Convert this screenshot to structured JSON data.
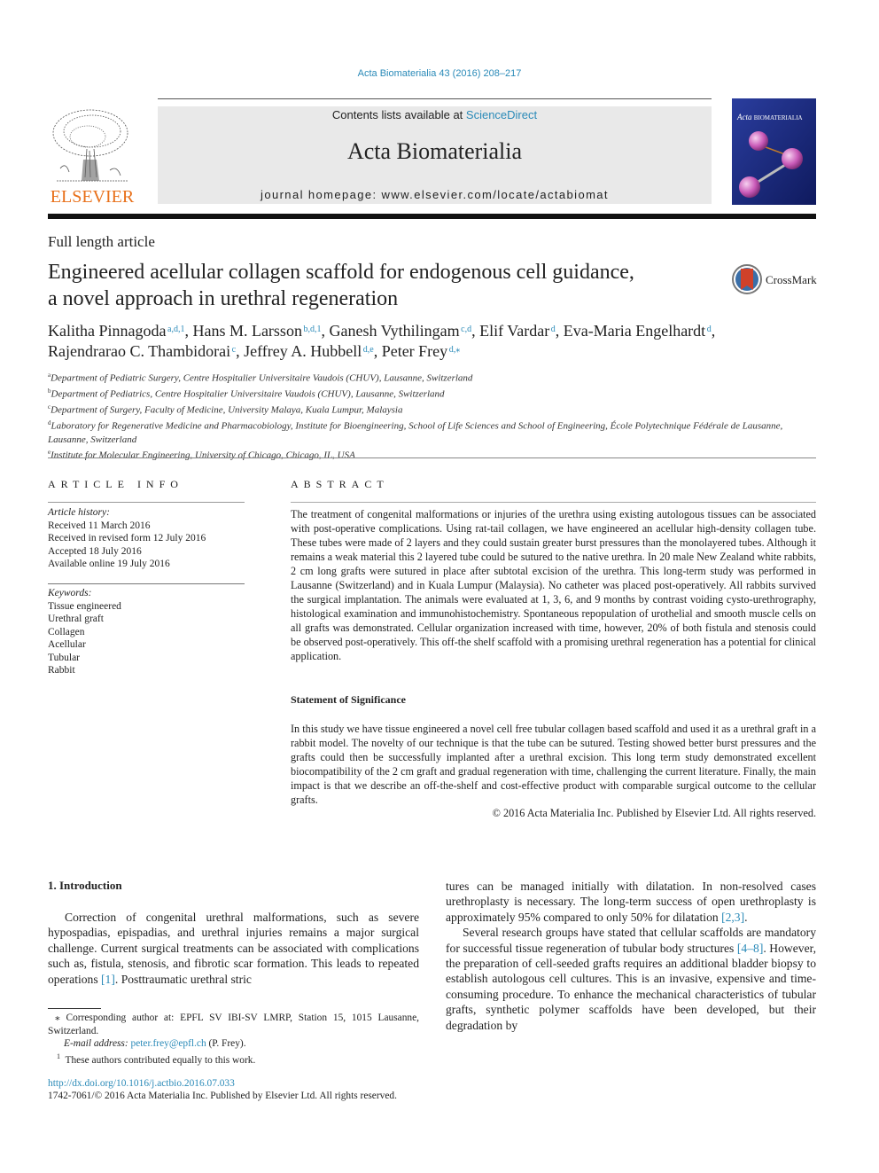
{
  "journal_reference": "Acta Biomaterialia 43 (2016) 208–217",
  "header": {
    "publisher_logo_text": "ELSEVIER",
    "contents_prefix": "Contents lists available at ",
    "contents_link": "ScienceDirect",
    "journal_title": "Acta Biomaterialia",
    "homepage": "journal homepage: www.elsevier.com/locate/actabiomat",
    "cover_title_italic": "Acta",
    "cover_title": "BIOMATERIALIA"
  },
  "article": {
    "type": "Full length article",
    "title_line1": "Engineered acellular collagen scaffold for endogenous cell guidance,",
    "title_line2": "a novel approach in urethral regeneration",
    "crossmark_label": "CrossMark",
    "authors": [
      {
        "name": "Kalitha Pinnagoda",
        "sup": "a,d,1",
        "sep": ", "
      },
      {
        "name": "Hans M. Larsson",
        "sup": "b,d,1",
        "sep": ", "
      },
      {
        "name": "Ganesh Vythilingam",
        "sup": "c,d",
        "sep": ", "
      },
      {
        "name": "Elif Vardar",
        "sup": "d",
        "sep": ", "
      },
      {
        "name": "Eva-Maria Engelhardt",
        "sup": "d",
        "sep": ","
      },
      {
        "name": "Rajendrarao C. Thambidorai",
        "sup": "c",
        "sep": ", "
      },
      {
        "name": "Jeffrey A. Hubbell",
        "sup": "d,e",
        "sep": ", "
      },
      {
        "name": "Peter Frey",
        "sup": "d,⁎",
        "sep": ""
      }
    ],
    "affiliations": [
      {
        "key": "a",
        "text": "Department of Pediatric Surgery, Centre Hospitalier Universitaire Vaudois (CHUV), Lausanne, Switzerland"
      },
      {
        "key": "b",
        "text": "Department of Pediatrics, Centre Hospitalier Universitaire Vaudois (CHUV), Lausanne, Switzerland"
      },
      {
        "key": "c",
        "text": "Department of Surgery, Faculty of Medicine, University Malaya, Kuala Lumpur, Malaysia"
      },
      {
        "key": "d",
        "text": "Laboratory for Regenerative Medicine and Pharmacobiology, Institute for Bioengineering, School of Life Sciences and School of Engineering, École Polytechnique Fédérale de Lausanne, Lausanne, Switzerland"
      },
      {
        "key": "e",
        "text": "Institute for Molecular Engineering, University of Chicago, Chicago, IL, USA"
      }
    ]
  },
  "article_info": {
    "heading": "ARTICLE INFO",
    "history_label": "Article history:",
    "history": [
      "Received 11 March 2016",
      "Received in revised form 12 July 2016",
      "Accepted 18 July 2016",
      "Available online 19 July 2016"
    ],
    "keywords_label": "Keywords:",
    "keywords": [
      "Tissue engineered",
      "Urethral graft",
      "Collagen",
      "Acellular",
      "Tubular",
      "Rabbit"
    ]
  },
  "abstract": {
    "heading": "ABSTRACT",
    "text": "The treatment of congenital malformations or injuries of the urethra using existing autologous tissues can be associated with post-operative complications. Using rat-tail collagen, we have engineered an acel­lular high-density collagen tube. These tubes were made of 2 layers and they could sustain greater burst pressures than the monolayered tubes. Although it remains a weak material this 2 layered tube could be sutured to the native urethra. In 20 male New Zealand white rabbits, 2 cm long grafts were sutured in place after subtotal excision of the urethra. This long-term study was performed in Lausanne (Switzerland) and in Kuala Lumpur (Malaysia). No catheter was placed post-operatively. All rabbits survived the surgical implantation. The animals were evaluated at 1, 3, 6, and 9 months by contrast voiding cysto-urethrography, histological examination and immunohistochemistry. Spontaneous re­population of urothelial and smooth muscle cells on all grafts was demonstrated. Cellular organization increased with time, however, 20% of both fistula and stenosis could be observed post-operatively. This off-the shelf scaffold with a promising urethral regeneration has a potential for clinical application.",
    "significance_heading": "Statement of Significance",
    "significance_text": "In this study we have tissue engineered a novel cell free tubular collagen based scaffold and used it as a urethral graft in a rabbit model. The novelty of our technique is that the tube can be sutured. Testing showed better burst pressures and the grafts could then be successfully implanted after a urethral excision. This long term study demonstrated excellent biocompatibility of the 2 cm graft and gradual regeneration with time, challenging the current literature. Finally, the main impact is that we describe an off-the-shelf and cost-effective product with comparable surgical outcome to the cellular grafts.",
    "copyright": "© 2016 Acta Materialia Inc. Published by Elsevier Ltd. All rights reserved."
  },
  "introduction": {
    "heading": "1. Introduction",
    "p1_a": "Correction of congenital urethral malformations, such as severe hypospadias, epispadias, and urethral injuries remains a major sur­gical challenge. Current surgical treatments can be associated with complications such as, fistula, stenosis, and fibrotic scar formation. This leads to repeated operations ",
    "p1_ref": "[1]",
    "p1_b": ". Posttraumatic urethral stric­",
    "col2_a": "tures can be managed initially with dilatation. In non-resolved cases urethroplasty is necessary. The long-term success of open urethroplasty is approximately 95% compared to only 50% for dilatation ",
    "col2_ref1": "[2,3]",
    "col2_b": ".",
    "p2_a": "Several research groups have stated that cellular scaffolds are mandatory for successful tissue regeneration of tubular body struc­tures ",
    "p2_ref": "[4–8]",
    "p2_b": ". However, the preparation of cell-seeded grafts requires an additional bladder biopsy to establish autologous cell cultures. This is an invasive, expensive and time-consuming procedure. To enhance the mechanical characteristics of tubular grafts, synthetic polymer scaffolds have been developed, but their degradation by"
  },
  "footnotes": {
    "corresponding": "⁎ Corresponding author at: EPFL SV IBI-SV LMRP, Station 15, 1015 Lausanne, Switzerland.",
    "email_label": "E-mail address: ",
    "email": "peter.frey@epfl.ch",
    "email_suffix": " (P. Frey).",
    "equal_sup": "1",
    "equal": "These authors contributed equally to this work.",
    "doi": "http://dx.doi.org/10.1016/j.actbio.2016.07.033",
    "issn": "1742-7061/© 2016 Acta Materialia Inc. Published by Elsevier Ltd. All rights reserved."
  }
}
